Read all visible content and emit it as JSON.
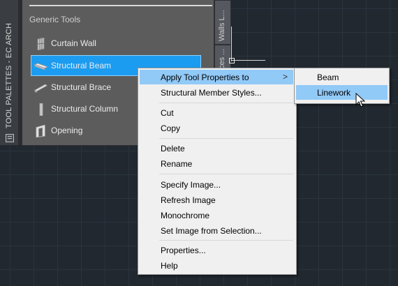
{
  "palette": {
    "title": "TOOL PALETTES - EC ARCH",
    "group_header": "Generic Tools",
    "tools": [
      {
        "label": "Curtain Wall",
        "icon": "curtain-wall-icon"
      },
      {
        "label": "Structural Beam",
        "icon": "structural-beam-icon",
        "selected": true
      },
      {
        "label": "Structural Brace",
        "icon": "structural-brace-icon"
      },
      {
        "label": "Structural Column",
        "icon": "structural-column-icon"
      },
      {
        "label": "Opening",
        "icon": "opening-icon"
      }
    ],
    "tabs": [
      "Walls L...",
      "ces ..."
    ]
  },
  "context_menu": {
    "items": [
      {
        "label": "Apply Tool Properties to",
        "has_submenu": true,
        "highlighted": true
      },
      {
        "label": "Structural Member Styles..."
      },
      {
        "label": "Cut"
      },
      {
        "label": "Copy"
      },
      {
        "label": "Delete"
      },
      {
        "label": "Rename"
      },
      {
        "label": "Specify Image..."
      },
      {
        "label": "Refresh Image"
      },
      {
        "label": "Monochrome"
      },
      {
        "label": "Set Image from Selection..."
      },
      {
        "label": "Properties..."
      },
      {
        "label": "Help"
      }
    ],
    "submenu_arrow": ">"
  },
  "submenu": {
    "items": [
      {
        "label": "Beam"
      },
      {
        "label": "Linework",
        "highlighted": true
      }
    ]
  },
  "colors": {
    "selection": "#1c9cf0",
    "menu_highlight": "#91c9f7",
    "palette_bg": "#5c5c5c",
    "canvas_bg": "#212830"
  }
}
